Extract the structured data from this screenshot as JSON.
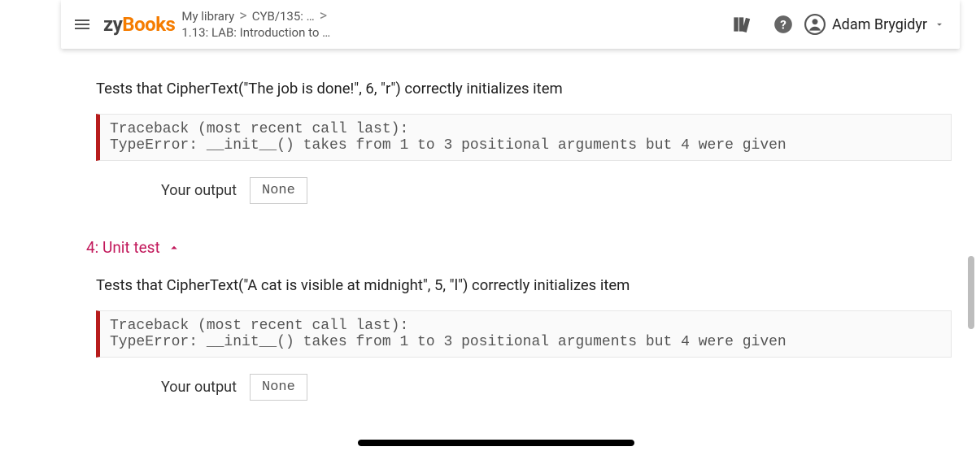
{
  "header": {
    "logo_zy": "zy",
    "logo_books": "Books",
    "breadcrumb_line1_a": "My library",
    "breadcrumb_sep1": ">",
    "breadcrumb_line1_b": "CYB/135: …",
    "breadcrumb_sep2": ">",
    "breadcrumb_line2": "1.13: LAB: Introduction to …",
    "user_name": "Adam Brygidyr"
  },
  "tests": {
    "t3": {
      "desc": "Tests that CipherText(\"The job is done!\", 6, \"r\") correctly initializes item",
      "trace": "Traceback (most recent call last):\nTypeError: __init__() takes from 1 to 3 positional arguments but 4 were given",
      "output_label": "Your output",
      "output_value": "None"
    },
    "t4": {
      "title": "4: Unit test",
      "desc": "Tests that CipherText(\"A cat is visible at midnight\", 5, \"l\") correctly initializes item",
      "trace": "Traceback (most recent call last):\nTypeError: __init__() takes from 1 to 3 positional arguments but 4 were given",
      "output_label": "Your output",
      "output_value": "None"
    }
  }
}
